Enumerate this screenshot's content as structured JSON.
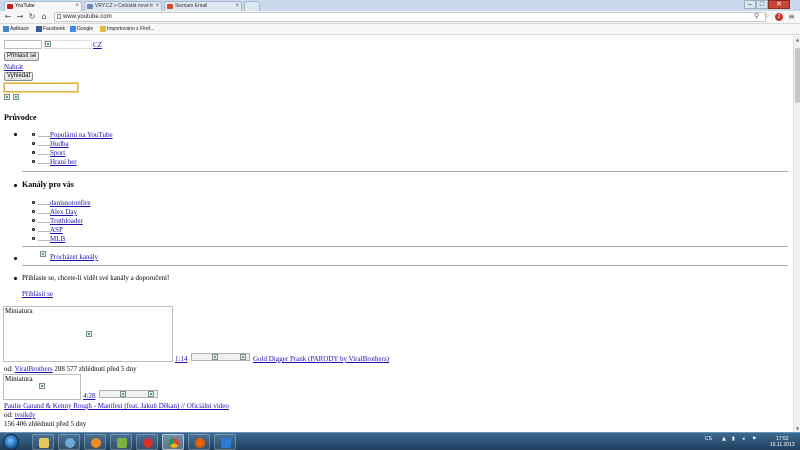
{
  "browser": {
    "tabs": [
      {
        "label": "YouTube",
        "color": "#cc181e"
      },
      {
        "label": "VRY.CZ » Celostát nové ti",
        "color": "#6b8bb5"
      },
      {
        "label": "Seznam Email",
        "color": "#d9472b"
      }
    ],
    "url": "www.youtube.com",
    "bookmarks": [
      {
        "label": "Aplikace",
        "color": "#4a86c5"
      },
      {
        "label": "Facebook",
        "color": "#3b5998"
      },
      {
        "label": "Google",
        "color": "#4285f4"
      },
      {
        "label": "Importováno z Firef...",
        "color": "#e5b94a"
      }
    ],
    "window_controls": {
      "minimize": "–",
      "maximize": "□",
      "close": "✕"
    },
    "extension_badge": "2"
  },
  "page": {
    "country": "CZ",
    "sign_in_button": "Přihlásit se",
    "upload_link": "Nahrát",
    "search_button": "Vyhledat",
    "search_value": "",
    "guide": {
      "title": "Průvodce",
      "items": [
        "Populární na YouTube",
        "Hudba",
        "Sport",
        "Hraní her"
      ]
    },
    "channels": {
      "title": "Kanály pro vás",
      "items": [
        "danisnotonfire",
        "Alex Day",
        "Truthloader",
        "ASP",
        "MLB"
      ]
    },
    "browse_channels": "Procházet kanály",
    "signin_prompt": "Přihlaste se, chcete-li vidět své kanály a doporučení!",
    "signin_link": "Přihlásit se",
    "videos": [
      {
        "thumb_label": "Miniatura",
        "duration": "1:14",
        "title": "Gold Digger Prank (PARODY by ViralBrothers)",
        "by": "od:",
        "channel": "ViralBrothers",
        "stats": "288 577 zhlédnutí před 5 dny"
      },
      {
        "thumb_label": "Miniatura",
        "duration": "4:28",
        "title": "Paulie Garand & Kenny Rough - Manifest (feat. Jakub Děkan) // Oficiální video",
        "by": "od:",
        "channel": "tvsikdy",
        "stats": "156 406 zhlédnutí před 5 dny"
      }
    ]
  },
  "taskbar": {
    "lang": "CS",
    "time": "17:52",
    "date": "16.11.2013"
  }
}
